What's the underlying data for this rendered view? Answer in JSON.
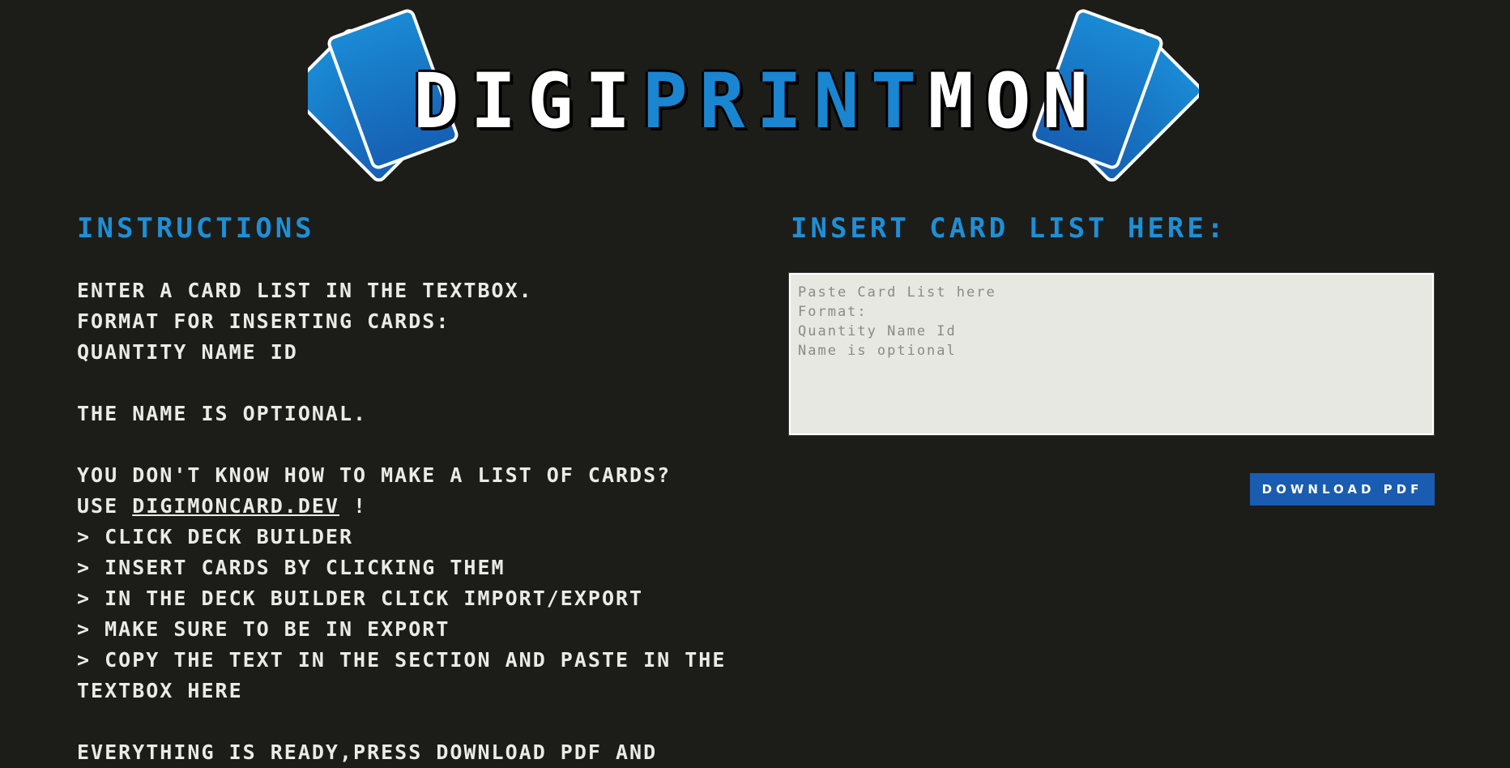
{
  "logo": {
    "part1": "DIGI",
    "part2": "PRINT",
    "part3": "MON"
  },
  "instructions": {
    "heading": "Instructions",
    "lines": {
      "l1": "Enter a card list in the textbox.",
      "l2": "Format for inserting cards:",
      "l3": "Quantity Name Id",
      "l4": "The Name is optional.",
      "l5": "You don't know how to make a list of cards?",
      "l6_prefix": "Use ",
      "l6_link": "digimoncard.dev",
      "l6_suffix": " !",
      "l7": "> Click Deck Builder",
      "l8": "> Insert cards by clicking them",
      "l9": "> In the Deck Builder click Import/Export",
      "l10": "> Make sure to be in Export",
      "l11": "> Copy the text in the section and paste in the",
      "l12": "textbox here",
      "l13": "Everything is ready,press Download PDF and"
    }
  },
  "card_input": {
    "heading": "Insert Card List here:",
    "placeholder": "Paste Card List here\nFormat:\nQuantity Name Id\nName is optional",
    "value": ""
  },
  "download_button": {
    "label": "Download PDF"
  },
  "colors": {
    "background": "#1c1c19",
    "accent_blue": "#1e8fd6",
    "button_blue": "#1a5cb0",
    "text": "#ebebe6"
  }
}
